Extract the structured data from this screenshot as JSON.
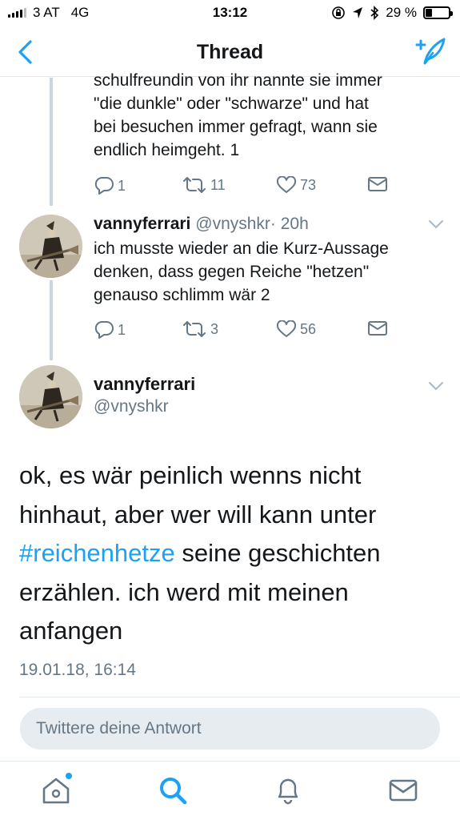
{
  "status_bar": {
    "carrier": "3 AT",
    "network": "4G",
    "time": "13:12",
    "battery": "29 %",
    "battery_level": 0.29
  },
  "nav": {
    "title": "Thread"
  },
  "tweets": [
    {
      "text_lines": [
        "schulfreundin von ihr nannte sie immer",
        "\"die dunkle\" oder \"schwarze\" und hat",
        "bei besuchen immer gefragt, wann sie",
        "endlich heimgeht. 1"
      ],
      "replies": "1",
      "retweets": "11",
      "likes": "73"
    },
    {
      "name": "vannyferrari",
      "handle": "@vnyshkr",
      "time": "· 20h",
      "text_lines": [
        "ich musste wieder an die Kurz-Aussage",
        "denken, dass gegen Reiche \"hetzen\"",
        "genauso schlimm wär 2"
      ],
      "replies": "1",
      "retweets": "3",
      "likes": "56"
    }
  ],
  "main_tweet": {
    "name": "vannyferrari",
    "handle": "@vnyshkr",
    "text_before": "ok, es wär peinlich wenns nicht hinhaut, aber wer will kann unter ",
    "hashtag": "#reichenhetze",
    "text_after": " seine geschichten erzählen. ich werd mit meinen anfangen",
    "date": "19.01.18, 16:14"
  },
  "reply": {
    "placeholder": "Twittere deine Antwort"
  },
  "tabbar": {
    "items": [
      "home-icon",
      "search-icon",
      "notifications-icon",
      "messages-icon"
    ]
  },
  "colors": {
    "accent": "#1da1f2",
    "secondary_text": "#657786",
    "reply_bg": "#e6ecf0"
  }
}
